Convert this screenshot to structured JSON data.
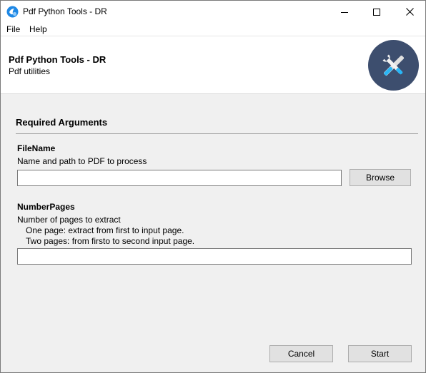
{
  "window": {
    "title": "Pdf Python Tools - DR",
    "controls": {
      "minimize": "minimize-icon",
      "maximize": "maximize-icon",
      "close": "close-icon"
    }
  },
  "menu": {
    "items": [
      {
        "label": "File"
      },
      {
        "label": "Help"
      }
    ]
  },
  "header": {
    "title": "Pdf Python Tools - DR",
    "subtitle": "Pdf utilities",
    "logo_icon": "tools-icon",
    "logo_color": "#3d4e6e"
  },
  "section": {
    "title": "Required Arguments"
  },
  "fields": {
    "filename": {
      "label": "FileName",
      "help": "Name and path to PDF to process",
      "value": "",
      "browse_label": "Browse"
    },
    "numberpages": {
      "label": "NumberPages",
      "help": "Number of pages to extract",
      "help_line2": "One page: extract from first to input page.",
      "help_line3": "Two pages: from firsto to second input page.",
      "value": ""
    }
  },
  "footer": {
    "cancel_label": "Cancel",
    "start_label": "Start"
  }
}
